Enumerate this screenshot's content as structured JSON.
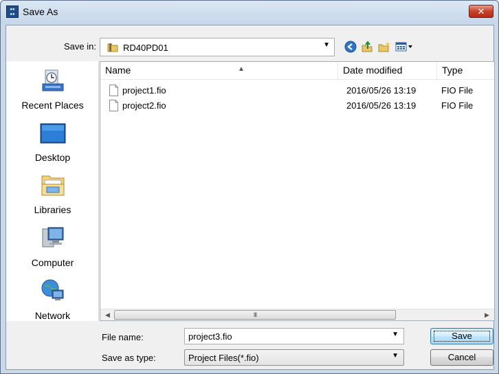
{
  "window": {
    "title": "Save As",
    "close_label": "✕"
  },
  "location": {
    "label": "Save in:",
    "value": "RD40PD01"
  },
  "places": [
    {
      "label": "Recent Places",
      "icon": "recent-places-icon"
    },
    {
      "label": "Desktop",
      "icon": "desktop-icon"
    },
    {
      "label": "Libraries",
      "icon": "libraries-icon"
    },
    {
      "label": "Computer",
      "icon": "computer-icon"
    },
    {
      "label": "Network",
      "icon": "network-icon"
    }
  ],
  "file_list": {
    "columns": [
      "Name",
      "Date modified",
      "Type"
    ],
    "rows": [
      {
        "name": "project1.fio",
        "date": "2016/05/26 13:19",
        "type": "FIO File"
      },
      {
        "name": "project2.fio",
        "date": "2016/05/26 13:19",
        "type": "FIO File"
      }
    ],
    "scroll_thumb_label": "III"
  },
  "form": {
    "file_name_label": "File name:",
    "file_name_value": "project3.fio",
    "type_label": "Save as type:",
    "type_value": "Project Files(*.fio)"
  },
  "buttons": {
    "save": "Save",
    "cancel": "Cancel"
  },
  "colors": {
    "titlebar": "#c6d7ea",
    "close": "#c7432b",
    "accent": "#3c7fb1"
  }
}
